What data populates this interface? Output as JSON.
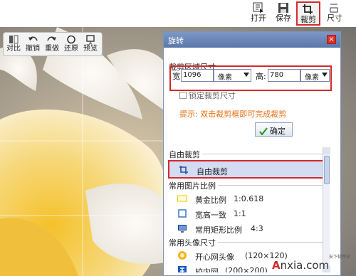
{
  "toolbar": {
    "open_label": "打开",
    "save_label": "保存",
    "crop_label": "裁剪",
    "size_label": "尺寸"
  },
  "minitools": {
    "compare_label": "对比",
    "undo_label": "撤销",
    "redo_label": "重做",
    "restore_label": "还原",
    "preview_label": "预览"
  },
  "panel": {
    "title": "旋转",
    "close_icon": "×",
    "section_title": "裁剪区域尺寸",
    "width_label": "宽:",
    "width_value": "1096",
    "width_unit": "像素",
    "height_label": "高:",
    "height_value": "780",
    "height_unit": "像素",
    "lock_label": "锁定裁剪尺寸",
    "hint": "提示: 双击裁剪框即可完成裁剪",
    "ok_label": "确定"
  },
  "list": {
    "group_free": "自由裁剪",
    "item_free": "自由裁剪",
    "group_ratio": "常用图片比例",
    "ratio_items": [
      {
        "label": "黄金比例",
        "ratio": "1:0.618"
      },
      {
        "label": "宽高一致",
        "ratio": "1:1"
      },
      {
        "label": "常用矩形比例",
        "ratio": "4:3"
      }
    ],
    "group_avatar": "常用头像尺寸",
    "avatar_items": [
      {
        "label": "开心网头像",
        "size": "(120×120)"
      },
      {
        "label": "校内网",
        "size": "(200×200)"
      }
    ]
  },
  "watermark": {
    "brand_a": "A",
    "brand_rest": "nxia.com",
    "sub": "安下软件站"
  },
  "colors": {
    "highlight_red": "#d42a2a",
    "panel_header": "#5a77aa",
    "hint_orange": "#e86d12",
    "selected_row": "#d3dcf3"
  }
}
